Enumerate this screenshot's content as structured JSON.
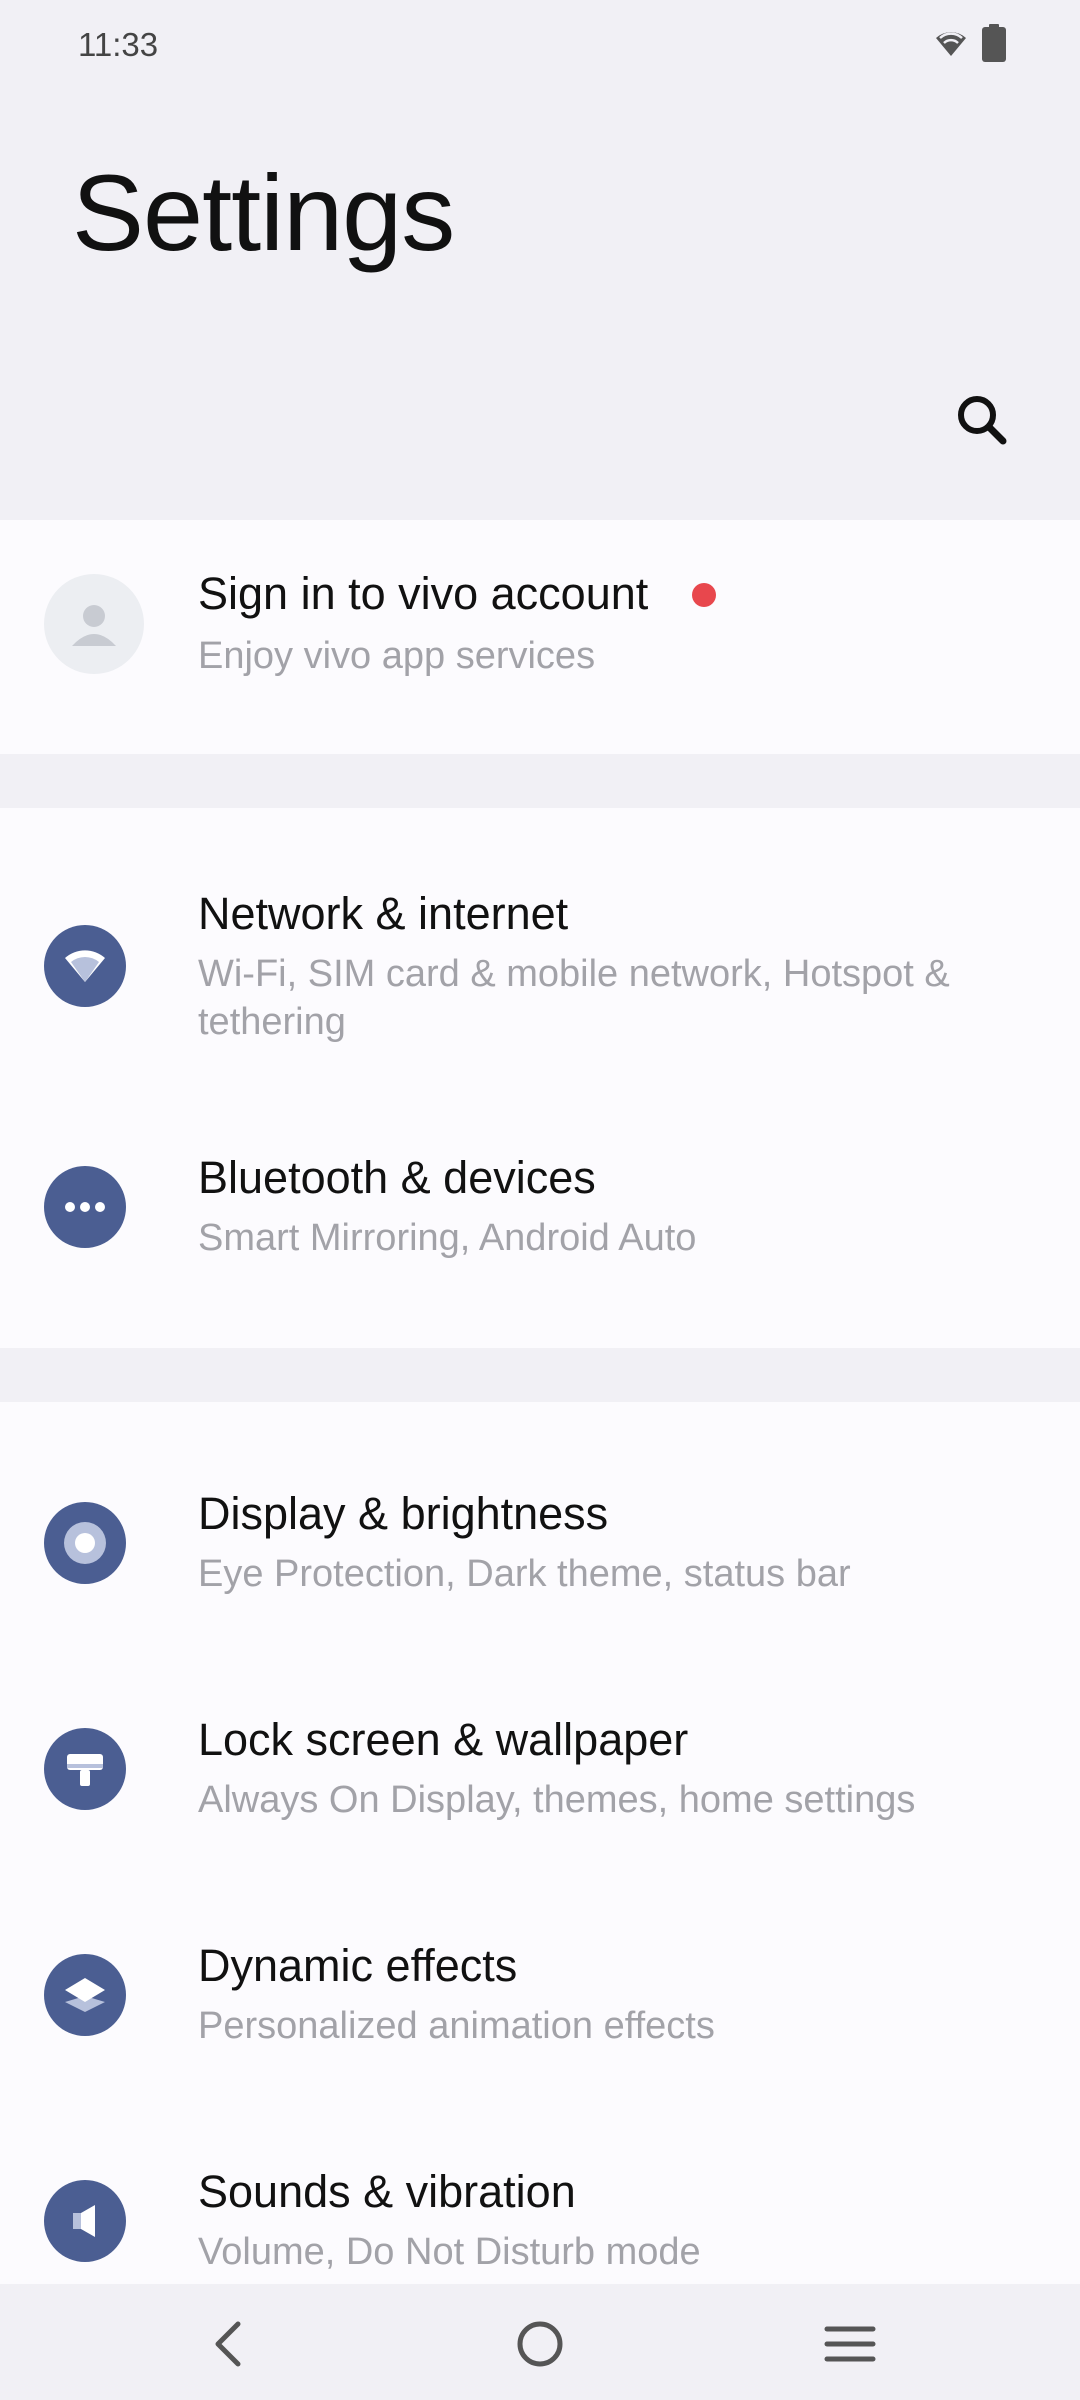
{
  "status_bar": {
    "time": "11:33",
    "icons": [
      "wifi-icon",
      "battery-icon"
    ]
  },
  "header": {
    "title": "Settings",
    "search_icon": "search-icon"
  },
  "account": {
    "title": "Sign in to vivo account",
    "subtitle": "Enjoy vivo app services",
    "notification_dot_color": "#e8474d"
  },
  "groups": [
    {
      "items": [
        {
          "title": "Network & internet",
          "subtitle": "Wi-Fi, SIM card & mobile network, Hotspot & tethering",
          "icon": "wifi-icon"
        },
        {
          "title": "Bluetooth & devices",
          "subtitle": "Smart Mirroring, Android Auto",
          "icon": "more-dots-icon"
        }
      ]
    },
    {
      "items": [
        {
          "title": "Display & brightness",
          "subtitle": "Eye Protection, Dark theme, status bar",
          "icon": "brightness-icon"
        },
        {
          "title": "Lock screen & wallpaper",
          "subtitle": "Always On Display, themes, home settings",
          "icon": "paint-brush-icon"
        },
        {
          "title": "Dynamic effects",
          "subtitle": "Personalized animation effects",
          "icon": "layers-icon"
        },
        {
          "title": "Sounds & vibration",
          "subtitle": "Volume, Do Not Disturb mode",
          "icon": "speaker-icon"
        }
      ]
    }
  ],
  "nav_bar": {
    "buttons": [
      "back-icon",
      "home-icon",
      "menu-icon"
    ]
  },
  "colors": {
    "background": "#f1f0f5",
    "card": "#fcfbfe",
    "icon_circle": "#4b5e92",
    "subtitle": "#a2a2a8"
  }
}
